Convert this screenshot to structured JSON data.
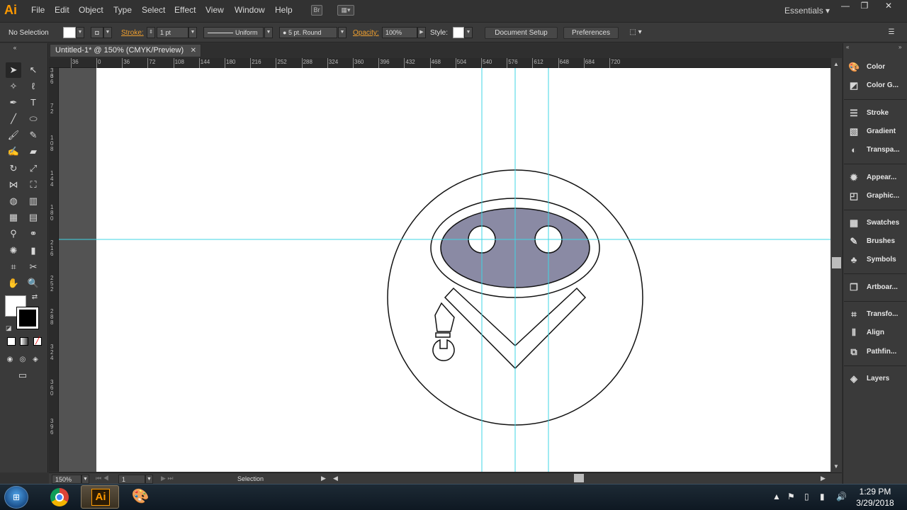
{
  "app": {
    "logo": "Ai",
    "workspace": "Essentials"
  },
  "menu": [
    "File",
    "Edit",
    "Object",
    "Type",
    "Select",
    "Effect",
    "View",
    "Window",
    "Help"
  ],
  "control_bar": {
    "selection_status": "No Selection",
    "stroke_label": "Stroke:",
    "stroke_weight": "1 pt",
    "profile": "Uniform",
    "brush": "5 pt. Round",
    "opacity_label": "Opacity:",
    "opacity": "100%",
    "style_label": "Style:",
    "document_setup": "Document Setup",
    "preferences": "Preferences"
  },
  "document": {
    "tab_title": "Untitled-1* @ 150% (CMYK/Preview)"
  },
  "ruler_h": [
    "36",
    "0",
    "36",
    "72",
    "108",
    "144",
    "180",
    "216",
    "252",
    "288",
    "324",
    "360",
    "396",
    "432",
    "468",
    "504",
    "540",
    "576",
    "612",
    "648",
    "684",
    "720"
  ],
  "ruler_v": [
    "3 6",
    "3 6",
    "7 2",
    "1 0 8",
    "1 4 4",
    "1 8 0",
    "2 1 6",
    "2 5 2",
    "2 8 8",
    "3 2 4",
    "3 6 0",
    "3 9 6"
  ],
  "status_bar": {
    "zoom": "150%",
    "artboard": "1",
    "tool": "Selection"
  },
  "right_panels": [
    "Color",
    "Color G...",
    "Stroke",
    "Gradient",
    "Transpa...",
    "Appear...",
    "Graphic...",
    "Swatches",
    "Brushes",
    "Symbols",
    "Artboar...",
    "Transfo...",
    "Align",
    "Pathfin...",
    "Layers"
  ],
  "panel_icons": [
    "palette-icon",
    "color-guide-icon",
    "stroke-icon",
    "gradient-icon",
    "transparency-icon",
    "appearance-icon",
    "graphic-styles-icon",
    "swatches-icon",
    "brushes-icon",
    "symbols-icon",
    "artboards-icon",
    "transform-icon",
    "align-icon",
    "pathfinder-icon",
    "layers-icon"
  ],
  "taskbar": {
    "time": "1:29 PM",
    "date": "3/29/2018",
    "ai_label": "Ai"
  },
  "colors": {
    "guide": "#3fd6e4",
    "visor": "#8a8aa4",
    "ui_bg": "#323232",
    "accent": "#ff9a00"
  }
}
